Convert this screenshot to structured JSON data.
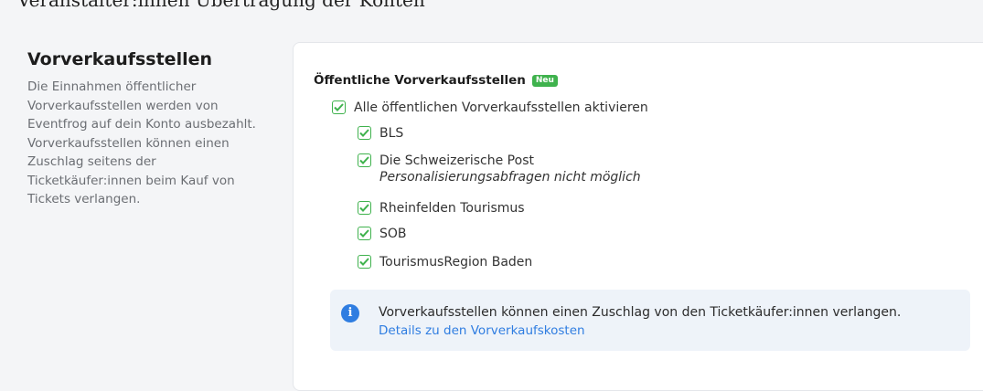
{
  "top_text": "Veranstalter:innen Übertragung der Konten",
  "section": {
    "title": "Vorverkaufsstellen",
    "description": "Die Einnahmen öffentlicher Vorverkaufsstellen werden von Eventfrog auf dein Konto ausbezahlt. Vorverkaufsstellen können einen Zuschlag seitens der Ticketkäufer:innen beim Kauf von Tickets verlangen."
  },
  "card": {
    "title": "Öffentliche Vorverkaufsstellen",
    "badge": "Neu",
    "all_label": "Alle öffentlichen Vorverkaufsstellen aktivieren",
    "options": [
      {
        "label": "BLS",
        "checked": true
      },
      {
        "label": "Die Schweizerische Post",
        "note": "Personalisierungsabfragen nicht möglich",
        "checked": true
      },
      {
        "label": "Rheinfelden Tourismus",
        "checked": true
      },
      {
        "label": "SOB",
        "checked": true
      },
      {
        "label": "TourismusRegion Baden",
        "checked": true
      }
    ],
    "info": {
      "text": "Vorverkaufsstellen können einen Zuschlag von den Ticketkäufer:innen verlangen.",
      "link": "Details zu den Vorverkaufskosten"
    }
  },
  "colors": {
    "accent_green": "#3fb24d",
    "info_blue": "#2f7de1",
    "info_bg": "#eef3f9"
  }
}
